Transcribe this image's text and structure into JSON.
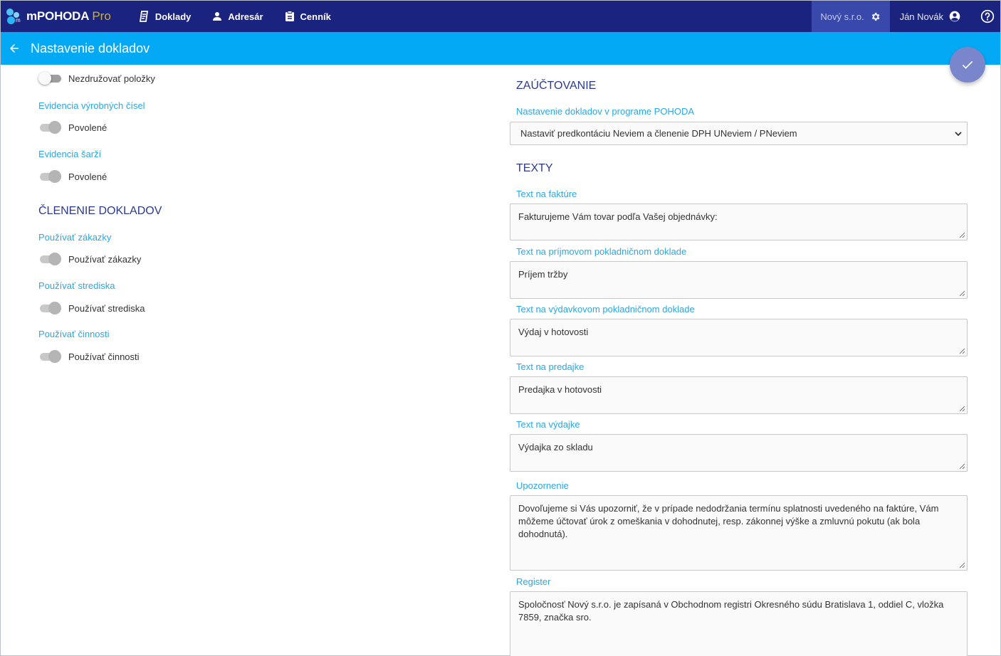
{
  "topbar": {
    "brand": "mPOHODA",
    "brand_suffix": "Pro",
    "nav": [
      {
        "label": "Doklady"
      },
      {
        "label": "Adresár"
      },
      {
        "label": "Cenník"
      }
    ],
    "company": "Nový s.r.o.",
    "user": "Ján Novák"
  },
  "subbar": {
    "title": "Nastavenie dokladov"
  },
  "left": {
    "nezdruzovat": {
      "label": "Nezdružovať položky",
      "on": false
    },
    "evidencia_vyrobnych": {
      "heading": "Evidencia výrobných čísel",
      "label": "Povolené"
    },
    "evidencia_sarzi": {
      "heading": "Evidencia šarží",
      "label": "Povolené"
    },
    "clenenie_title": "ČLENENIE DOKLADOV",
    "zakazky": {
      "heading": "Používať zákazky",
      "label": "Používať zákazky"
    },
    "strediska": {
      "heading": "Používať strediska",
      "label": "Používať strediska"
    },
    "cinnosti": {
      "heading": "Používať činnosti",
      "label": "Používať činnosti"
    }
  },
  "right": {
    "zauctovanie_title": "ZAÚČTOVANIE",
    "pohoda_label": "Nastavenie dokladov v programe POHODA",
    "pohoda_value": "Nastaviť predkontáciu Neviem a členenie DPH UNeviem / PNeviem",
    "texty_title": "TEXTY",
    "fields": [
      {
        "label": "Text na faktúre",
        "value": "Fakturujeme Vám tovar podľa Vašej objednávky:"
      },
      {
        "label": "Text na príjmovom pokladničnom doklade",
        "value": "Príjem tržby"
      },
      {
        "label": "Text na výdavkovom pokladničnom doklade",
        "value": "Výdaj v hotovosti"
      },
      {
        "label": "Text na predajke",
        "value": "Predajka v hotovosti"
      },
      {
        "label": "Text na výdajke",
        "value": "Výdajka zo skladu"
      },
      {
        "label": "Upozornenie",
        "value": "Dovoľujeme si Vás upozorniť, že v prípade nedodržania termínu splatnosti uvedeného na faktúre, Vám môžeme účtovať úrok z omeškania v dohodnutej, resp. zákonnej výške a zmluvnú pokutu (ak bola dohodnutá)."
      },
      {
        "label": "Register",
        "value": "Spoločnosť Nový s.r.o. je zapísaná v Obchodnom registri Okresného súdu Bratislava 1, oddiel C, vložka 7859, značka sro."
      }
    ]
  },
  "colors": {
    "navbar": "#1a237e",
    "subbar": "#03a9f4",
    "accent_label": "#29a8e6",
    "heading": "#2b3a8c",
    "fab": "#7986cb"
  }
}
